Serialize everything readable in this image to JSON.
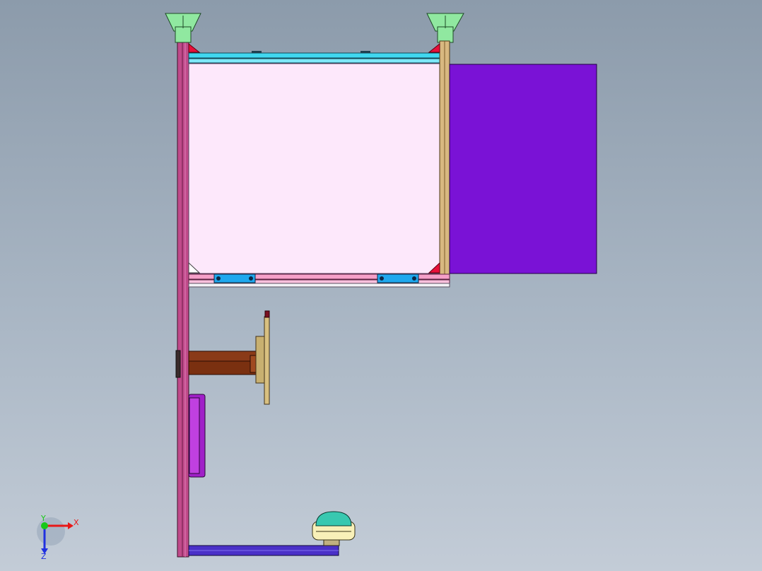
{
  "viewport": {
    "background_top": "#8c9bab",
    "background_bottom": "#c3ccd7"
  },
  "model": {
    "frame_color": "#c04a8a",
    "panel_color": "#fde8fb",
    "door_color": "#7a12d6",
    "rail_top_color": "#40d8f0",
    "rail_bottom_color": "#f5a0c8",
    "slider_color": "#1fa8ee",
    "foot_color": "#90e8a0",
    "bracket_color": "#e8103a",
    "post_right_color": "#d8b880",
    "arm_color": "#8a3a18",
    "plate_color": "#c8b070",
    "box_color": "#a020c8",
    "base_beam_color": "#4a30c8",
    "lamp_top_color": "#38c8b0",
    "lamp_body_color": "#f8f0b8"
  },
  "triad": {
    "x_label": "X",
    "y_label": "Y",
    "z_label": "Z",
    "x_color": "#e81818",
    "y_color": "#18c818",
    "z_color": "#2030e0"
  }
}
